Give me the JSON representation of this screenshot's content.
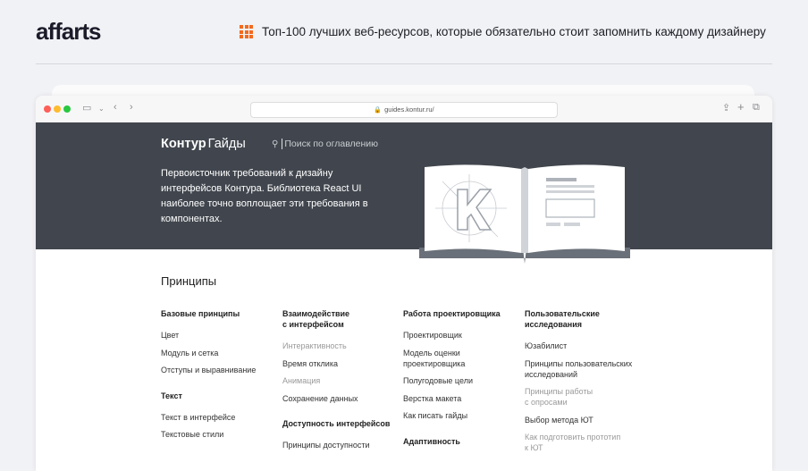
{
  "site": {
    "logo": "affarts",
    "article_title": "Топ-100 лучших веб-ресурсов, которые обязательно стоит запомнить каждому дизайнеру",
    "accent_color": "#f26a1e"
  },
  "browser": {
    "url": "guides.kontur.ru/"
  },
  "page": {
    "brand_bold": "Контур",
    "brand_light": "Гайды",
    "search_placeholder": "Поиск по оглавлению",
    "hero_text": "Первоисточник требований к дизайну интерфейсов Контура. Библиотека React UI наиболее точно воплощает эти требования в компонентах.",
    "section_title": "Принципы"
  },
  "columns": [
    {
      "groups": [
        {
          "heading": "Базовые принципы",
          "items": [
            {
              "label": "Цвет",
              "muted": false
            },
            {
              "label": "Модуль и сетка",
              "muted": false
            },
            {
              "label": "Отступы и выравнивание",
              "muted": false
            }
          ]
        },
        {
          "heading": "Текст",
          "items": [
            {
              "label": "Текст в интерфейсе",
              "muted": false
            },
            {
              "label": "Текстовые стили",
              "muted": false
            }
          ]
        }
      ]
    },
    {
      "groups": [
        {
          "heading": "Взаимодействие\nс интерфейсом",
          "items": [
            {
              "label": "Интерактивность",
              "muted": true
            },
            {
              "label": "Время отклика",
              "muted": false
            },
            {
              "label": "Анимация",
              "muted": true
            },
            {
              "label": "Сохранение данных",
              "muted": false
            }
          ]
        },
        {
          "heading": "Доступность интерфейсов",
          "items": [
            {
              "label": "Принципы доступности",
              "muted": false
            }
          ]
        }
      ]
    },
    {
      "groups": [
        {
          "heading": "Работа проектировщика",
          "items": [
            {
              "label": "Проектировщик",
              "muted": false
            },
            {
              "label": "Модель оценки\nпроектировщика",
              "muted": false
            },
            {
              "label": "Полугодовые цели",
              "muted": false
            },
            {
              "label": "Верстка макета",
              "muted": false
            },
            {
              "label": "Как писать гайды",
              "muted": false
            }
          ]
        },
        {
          "heading": "Адаптивность",
          "items": []
        }
      ]
    },
    {
      "groups": [
        {
          "heading": "Пользовательские\nисследования",
          "items": [
            {
              "label": "Юзабилист",
              "muted": false
            },
            {
              "label": "Принципы пользовательских\nисследований",
              "muted": false
            },
            {
              "label": "Принципы работы\nс опросами",
              "muted": true
            },
            {
              "label": "Выбор метода ЮТ",
              "muted": false
            },
            {
              "label": "Как подготовить прототип\nк ЮТ",
              "muted": true
            }
          ]
        }
      ]
    }
  ]
}
